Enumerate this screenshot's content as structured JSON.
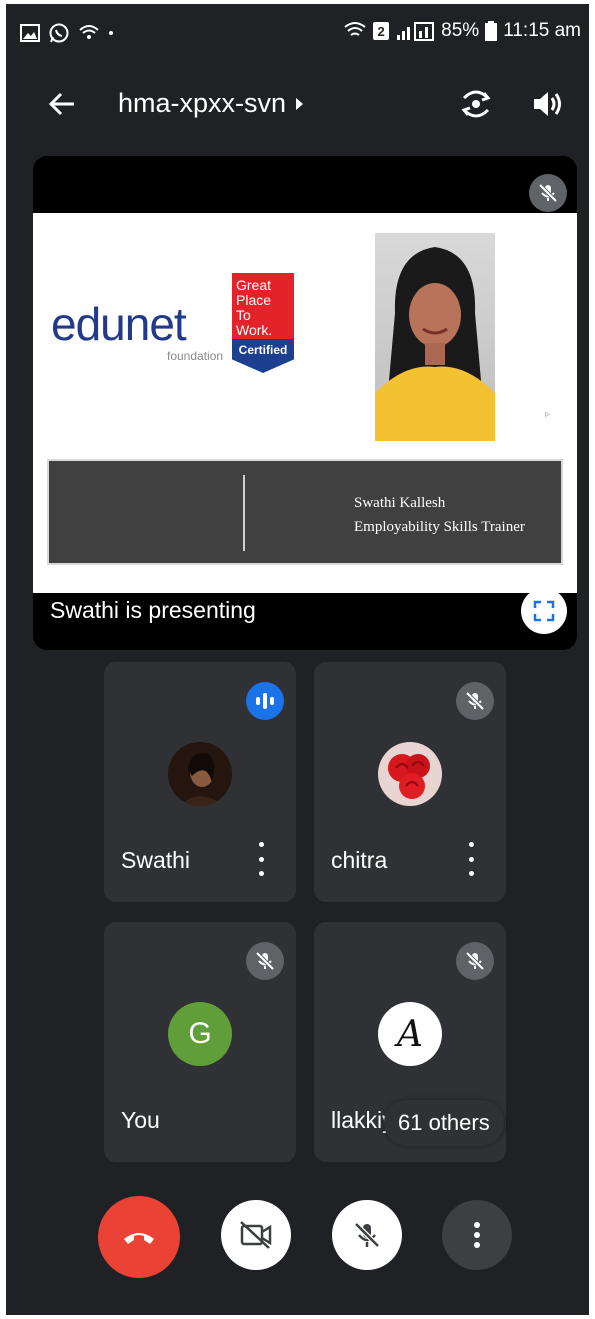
{
  "status_bar": {
    "battery": "85%",
    "time": "11:15 am",
    "sim_slot": "2"
  },
  "header": {
    "meeting_code": "hma-xpxx-svn"
  },
  "presentation": {
    "logo_text": "edunet",
    "logo_sub": "foundation",
    "badge_lines": [
      "Great",
      "Place",
      "To",
      "Work."
    ],
    "badge_certified": "Certified",
    "trainer_name": "Swathi Kallesh",
    "trainer_role": "Employability Skills Trainer",
    "presenting_label": "Swathi is presenting"
  },
  "participants": [
    {
      "name": "Swathi",
      "muted": false,
      "speaking": true
    },
    {
      "name": "chitra",
      "muted": true
    },
    {
      "name": "You",
      "muted": true,
      "initial": "G",
      "avatar_color": "#5f9e38"
    },
    {
      "name": "llakkiya",
      "muted": true,
      "initial": "A"
    }
  ],
  "others_label": "61 others",
  "colors": {
    "end_call": "#ea4335",
    "speaking": "#1a73e8",
    "background": "#1f2124",
    "tile": "#2f3134"
  }
}
